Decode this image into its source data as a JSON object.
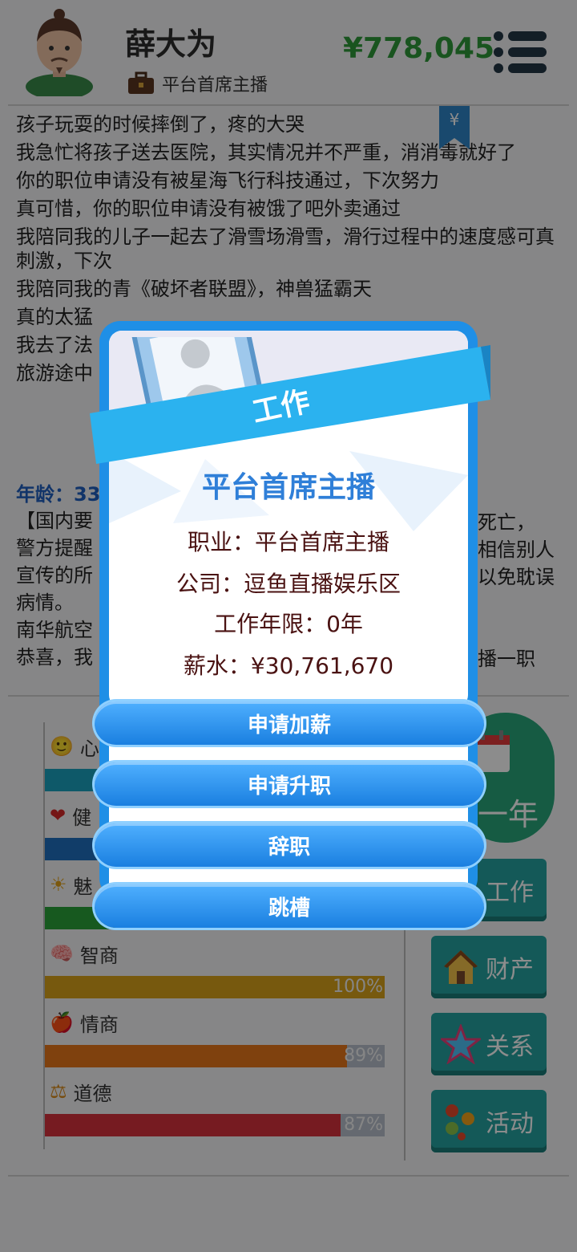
{
  "header": {
    "name": "薛大为",
    "job_title": "平台首席主播",
    "money": "¥778,045"
  },
  "log_entries": [
    "孩子玩耍的时候摔倒了，疼的大哭",
    "我急忙将孩子送去医院，其实情况并不严重，消消毒就好了",
    "你的职位申请没有被星海飞行科技通过，下次努力",
    "真可惜，你的职位申请没有被饿了吧外卖通过",
    "我陪同我的儿子一起去了滑雪场滑雪，滑行过程中的速度感可真刺激，下次",
    "我陪同我的青",
    "真的太猛",
    "我去了法",
    "旅游途中"
  ],
  "log_partials": {
    "right_line6": "》，神兽猛霸天",
    "line6_mid": "《破坏者联盟"
  },
  "age_label": "年龄：33",
  "log2_entries": [
    "【国内要",
    "警方提醒",
    "宣传的所",
    "病情。",
    "南华航空",
    "恭喜，我"
  ],
  "log2_right": [
    "死亡，",
    "相信别人",
    "以免耽误",
    "",
    "",
    "播一职"
  ],
  "stats": [
    {
      "label": "心",
      "percent": 1.0,
      "pct_text": "",
      "color": "#1aa2c0"
    },
    {
      "label": "健",
      "percent": 1.0,
      "pct_text": "",
      "color": "#1f6fbf"
    },
    {
      "label": "魅",
      "percent": 1.0,
      "pct_text": "",
      "color": "#2aa33a"
    },
    {
      "label": "智商",
      "percent": 1.0,
      "pct_text": "100%",
      "color": "#d9a31a"
    },
    {
      "label": "情商",
      "percent": 0.89,
      "pct_text": "89%",
      "color": "#e8771a"
    },
    {
      "label": "道德",
      "percent": 0.87,
      "pct_text": "87%",
      "color": "#d8323c"
    }
  ],
  "side_buttons": {
    "next_year": "一年",
    "work": "工作",
    "property": "财产",
    "relations": "关系",
    "activities": "活动"
  },
  "dialog": {
    "ribbon_text": "工作",
    "title": "平台首席主播",
    "occupation": "职业：平台首席主播",
    "company": "公司：逗鱼直播娱乐区",
    "years": "工作年限：0年",
    "salary": "薪水：¥30,761,670",
    "buttons": {
      "raise": "申请加薪",
      "promotion": "申请升职",
      "resign": "辞职",
      "job_hop": "跳槽"
    }
  }
}
